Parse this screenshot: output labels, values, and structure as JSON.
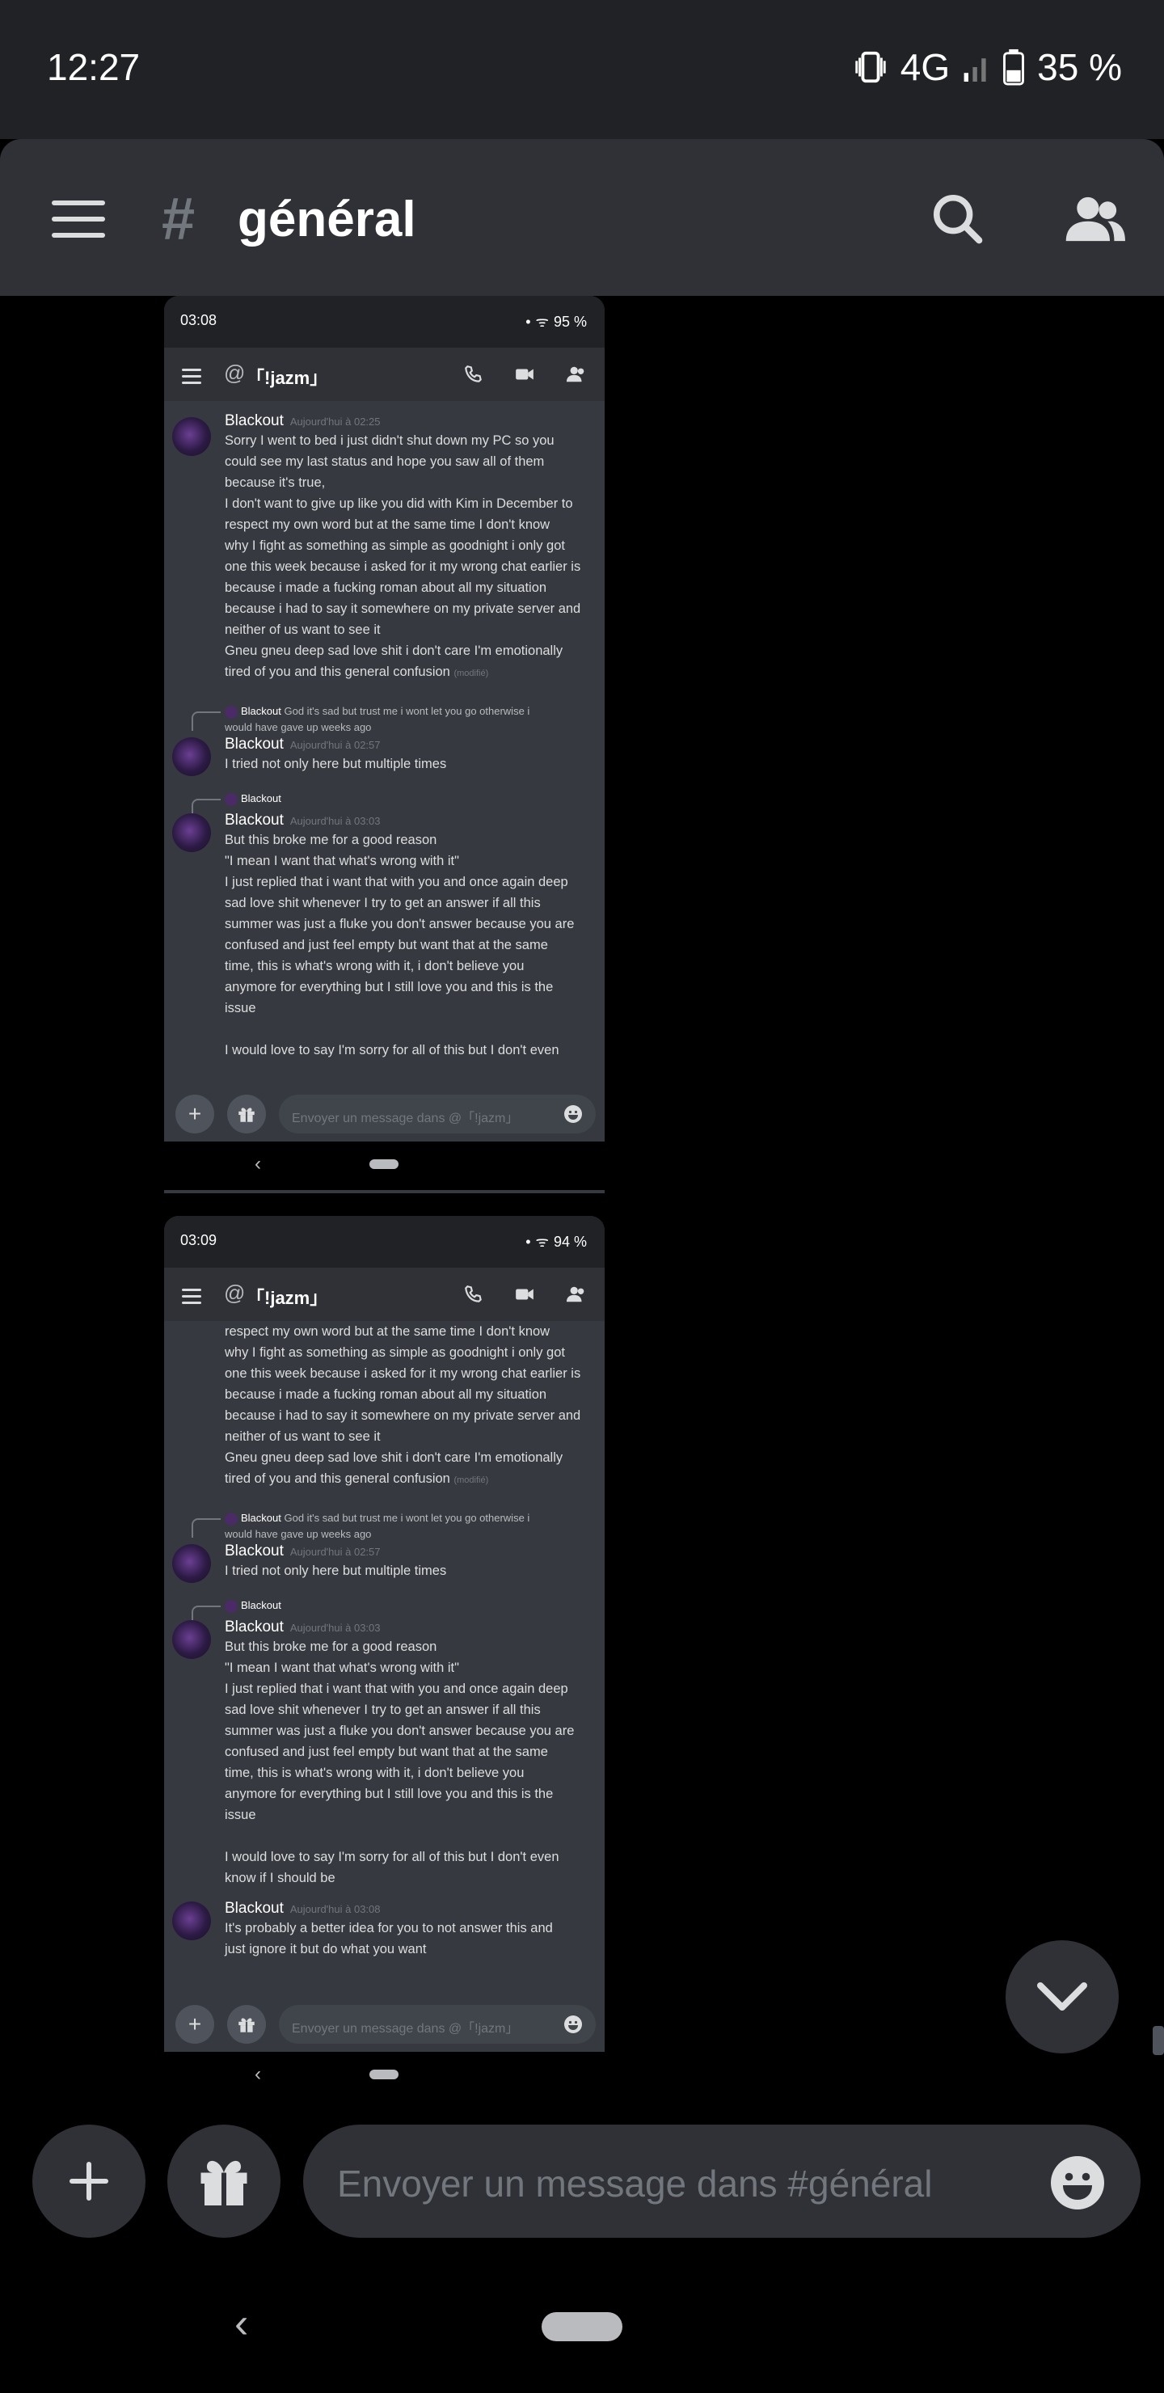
{
  "status_bar": {
    "time": "12:27",
    "network": "4G",
    "battery": "35 %"
  },
  "header": {
    "channel_symbol": "#",
    "channel_name": "général"
  },
  "composer": {
    "placeholder": "Envoyer un message dans #général",
    "add_label": "+"
  },
  "shot1": {
    "time": "03:08",
    "battery": "95 %",
    "dm_name": "「!jazm」",
    "input_placeholder": "Envoyer un message dans @「!jazm」",
    "messages": [
      {
        "author": "Blackout",
        "timestamp": "Aujourd'hui à 02:25",
        "lines": [
          "Sorry I went to bed i just didn't shut down my PC so you",
          "could see my last status and hope you saw all of them",
          "because it's true,",
          "I don't want to give up like you did with Kim in December to",
          "respect my own word but at the same time I don't know",
          "why I fight as something as simple as goodnight i only got",
          "one this week because i asked for it my wrong chat earlier is",
          "because i made a fucking roman about all my situation",
          "because i had to say it somewhere on my private server and",
          "neither of us want to see it",
          "Gneu gneu deep sad love shit i don't care I'm emotionally",
          "tired of you and this general confusion"
        ],
        "edited": "(modifié)"
      },
      {
        "reply_author": "Blackout",
        "reply_text_1": "God it's sad but trust me i wont let you go otherwise i",
        "reply_text_2": "would have gave up weeks ago",
        "author": "Blackout",
        "timestamp": "Aujourd'hui à 02:57",
        "lines": [
          "I tried not only here but multiple times"
        ]
      },
      {
        "reply_author": "Blackout",
        "author": "Blackout",
        "timestamp": "Aujourd'hui à 03:03",
        "lines": [
          "But this broke me for a good reason",
          "\"I mean I want that what's wrong with it\"",
          "I just replied that i want that with you and once again deep",
          "sad love shit whenever I try to get an answer if all this",
          "summer was just a fluke you don't answer because you are",
          "confused and just feel empty but want that at the same",
          "time, this is what's wrong with it, i don't believe you",
          "anymore for everything but I still love you and this is the",
          "issue",
          "",
          "I would love to say I'm sorry for all of this but I don't even"
        ]
      }
    ]
  },
  "shot2": {
    "time": "03:09",
    "battery": "94 %",
    "dm_name": "「!jazm」",
    "input_placeholder": "Envoyer un message dans @「!jazm」",
    "top_lines": [
      "respect my own word but at the same time I don't know",
      "why I fight as something as simple as goodnight i only got",
      "one this week because i asked for it my wrong chat earlier is",
      "because i made a fucking roman about all my situation",
      "because i had to say it somewhere on my private server and",
      "neither of us want to see it",
      "Gneu gneu deep sad love shit i don't care I'm emotionally",
      "tired of you and this general confusion"
    ],
    "top_edited": "(modifié)",
    "messages": [
      {
        "reply_author": "Blackout",
        "reply_text_1": "God it's sad but trust me i wont let you go otherwise i",
        "reply_text_2": "would have gave up weeks ago",
        "author": "Blackout",
        "timestamp": "Aujourd'hui à 02:57",
        "lines": [
          "I tried not only here but multiple times"
        ]
      },
      {
        "reply_author": "Blackout",
        "author": "Blackout",
        "timestamp": "Aujourd'hui à 03:03",
        "lines": [
          "But this broke me for a good reason",
          "\"I mean I want that what's wrong with it\"",
          "I just replied that i want that with you and once again deep",
          "sad love shit whenever I try to get an answer if all this",
          "summer was just a fluke you don't answer because you are",
          "confused and just feel empty but want that at the same",
          "time, this is what's wrong with it, i don't believe you",
          "anymore for everything but I still love you and this is the",
          "issue",
          "",
          "I would love to say I'm sorry for all of this but I don't even",
          "know if I should be"
        ]
      },
      {
        "author": "Blackout",
        "timestamp": "Aujourd'hui à 03:08",
        "lines": [
          "It's probably a better idea for you to not answer this and",
          "just ignore it but do what you want"
        ]
      }
    ]
  }
}
